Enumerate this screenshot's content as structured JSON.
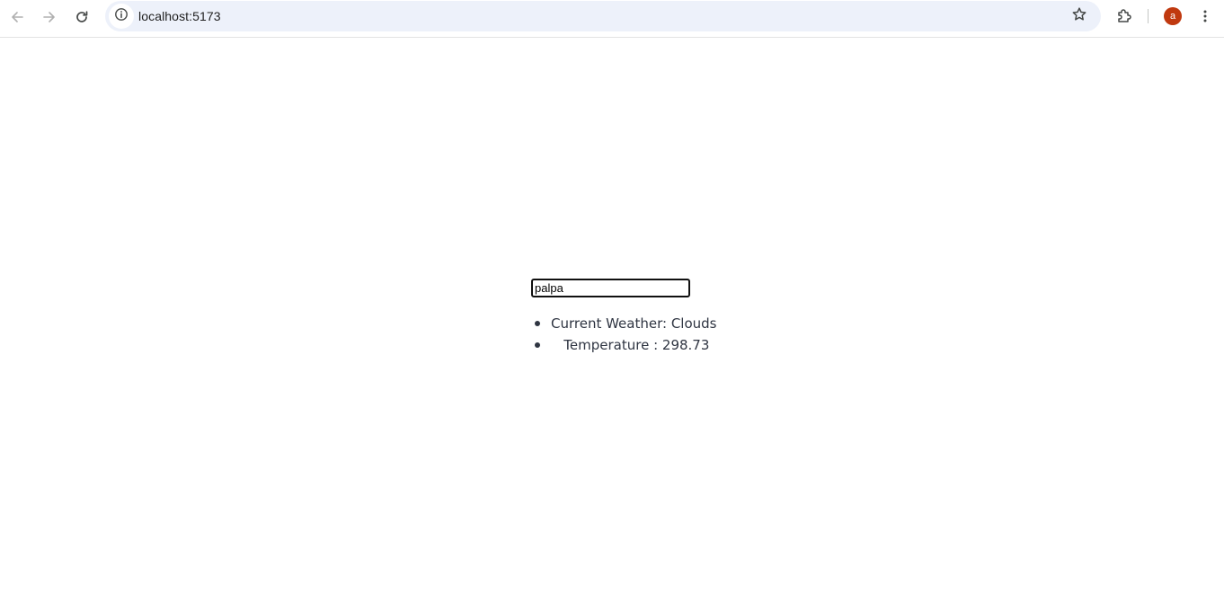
{
  "browser": {
    "url": "localhost:5173",
    "profile_initial": "a",
    "icons": {
      "back": "arrow-left-icon",
      "forward": "arrow-right-icon",
      "reload": "reload-icon",
      "site_info": "info-icon",
      "bookmark": "star-icon",
      "extensions": "puzzle-icon",
      "menu": "kebab-menu-icon"
    },
    "colors": {
      "omnibox_bg": "#edf1fa",
      "avatar_bg": "#c0390f"
    }
  },
  "app": {
    "search": {
      "value": "palpa",
      "placeholder": ""
    },
    "weather": {
      "items": [
        {
          "text": "Current Weather: Clouds"
        },
        {
          "text": "   Temperature : 298.73"
        }
      ]
    }
  }
}
